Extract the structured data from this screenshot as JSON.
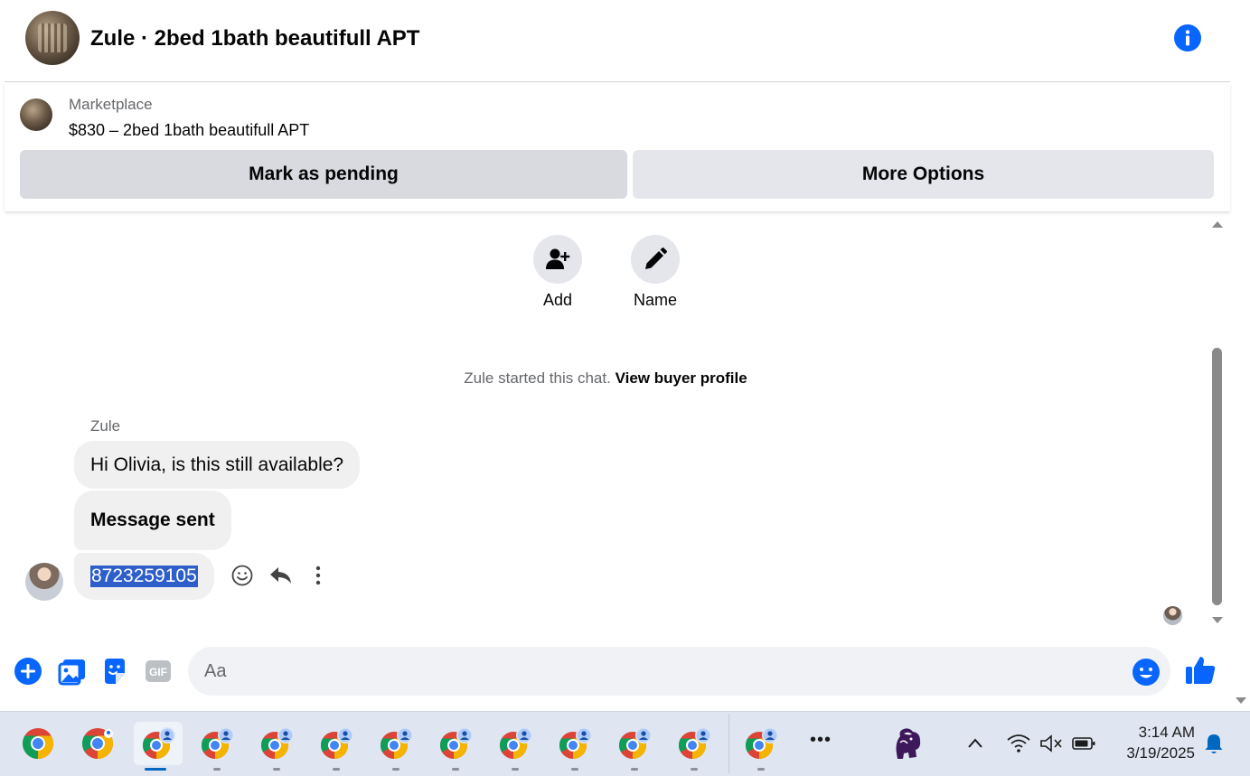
{
  "header": {
    "title": "Zule · 2bed 1bath beautifull APT",
    "info_icon": "info-icon"
  },
  "marketplace": {
    "label": "Marketplace",
    "listing": "$830 – 2bed 1bath beautifull APT",
    "mark_pending_label": "Mark as pending",
    "more_options_label": "More Options"
  },
  "actions": {
    "add_label": "Add",
    "name_label": "Name"
  },
  "chat": {
    "started_text": "Zule started this chat.",
    "view_profile_link": "View buyer profile",
    "sender_name": "Zule",
    "messages": [
      "Hi Olivia, is this still available?",
      "Message sent",
      "8723259105"
    ]
  },
  "composer": {
    "placeholder": "Aa"
  },
  "taskbar": {
    "time": "3:14 AM",
    "date": "3/19/2025",
    "more_label": "•••"
  },
  "colors": {
    "accent": "#0866ff",
    "bubble": "#f0f0f0",
    "selection": "#2d5ec9"
  }
}
